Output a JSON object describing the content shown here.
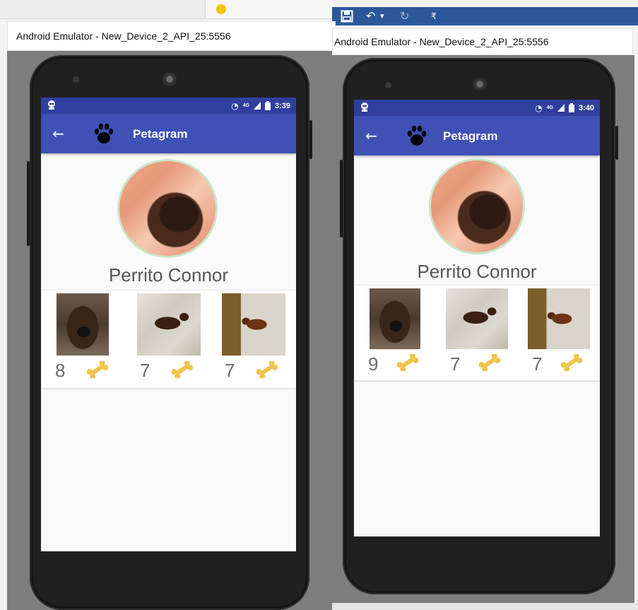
{
  "left_window": {
    "title": "Android Emulator - New_Device_2_API_25:5556"
  },
  "right_window": {
    "title": "Android Emulator - New_Device_2_API_25:5556",
    "ribbon": {
      "undo_dropdown": "▾",
      "customize_arrow": "₹"
    }
  },
  "left_phone": {
    "status_time": "3:39",
    "network": "4G",
    "toolbar": {
      "back_icon": "←",
      "title": "Petagram",
      "paw_icon": "paw-icon"
    },
    "pet_name": "Perrito Connor",
    "photos": [
      {
        "likes": "8",
        "icon": "bone-icon"
      },
      {
        "likes": "7",
        "icon": "bone-icon"
      },
      {
        "likes": "7",
        "icon": "bone-icon"
      }
    ]
  },
  "right_phone": {
    "status_time": "3:40",
    "network": "4G",
    "toolbar": {
      "back_icon": "←",
      "title": "Petagram",
      "paw_icon": "paw-icon"
    },
    "pet_name": "Perrito Connor",
    "photos": [
      {
        "likes": "9",
        "icon": "bone-icon"
      },
      {
        "likes": "7",
        "icon": "bone-icon"
      },
      {
        "likes": "7",
        "icon": "bone-icon"
      }
    ]
  },
  "colors": {
    "primary": "#3f51b5",
    "primary_dark": "#303f9f",
    "ribbon_blue": "#2b579a",
    "bone": "#f2c34a",
    "avatar_border": "#c8e6c9"
  }
}
